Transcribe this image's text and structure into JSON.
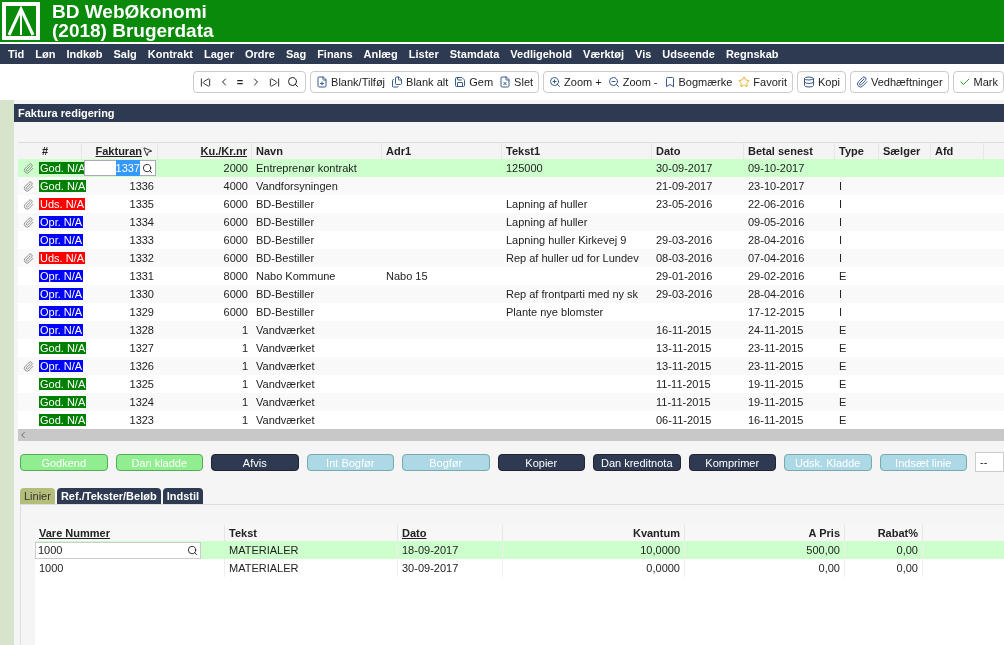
{
  "app": {
    "title": "BD WebØkonomi",
    "subtitle": "(2018) Brugerdata"
  },
  "menu": [
    "Tid",
    "Løn",
    "Indkøb",
    "Salg",
    "Kontrakt",
    "Lager",
    "Ordre",
    "Sag",
    "Finans",
    "Anlæg",
    "Lister",
    "Stamdata",
    "Vedligehold",
    "Værktøj",
    "Vis",
    "Udseende",
    "Regnskab"
  ],
  "toolbar": {
    "nav_label": "=",
    "groups": [
      [
        "Blank/Tilføj",
        "Blank alt",
        "Gem",
        "Slet"
      ],
      [
        "Zoom +",
        "Zoom -",
        "Bogmærke",
        "Favorit"
      ],
      [
        "Kopi"
      ],
      [
        "Vedhæftninger"
      ],
      [
        "Mark"
      ]
    ]
  },
  "panel": {
    "title": "Faktura redigering"
  },
  "table": {
    "columns": [
      {
        "label": "#",
        "sortable": false
      },
      {
        "label": "Fakturan",
        "sortable": true
      },
      {
        "label": "Ku./Kr.nr",
        "sortable": true
      },
      {
        "label": "Navn",
        "sortable": false
      },
      {
        "label": "Adr1",
        "sortable": false
      },
      {
        "label": "Tekst1",
        "sortable": false
      },
      {
        "label": "Dato",
        "sortable": false
      },
      {
        "label": "Betal senest",
        "sortable": false
      },
      {
        "label": "Type",
        "sortable": false
      },
      {
        "label": "Sælger",
        "sortable": false
      },
      {
        "label": "Afd",
        "sortable": false
      }
    ],
    "rows": [
      {
        "selected": true,
        "attachment": true,
        "status": "God. N/A",
        "color": "#008000",
        "fakturanr": "1337",
        "kunr": "2000",
        "navn": "Entreprenør kontrakt",
        "adr1": "",
        "tekst1": "125000",
        "dato": "30-09-2017",
        "betal": "09-10-2017",
        "type": ""
      },
      {
        "selected": false,
        "attachment": true,
        "status": "God. N/A",
        "color": "#008000",
        "fakturanr": "1336",
        "kunr": "4000",
        "navn": "Vandforsyningen",
        "adr1": "",
        "tekst1": "",
        "dato": "21-09-2017",
        "betal": "23-10-2017",
        "type": "I"
      },
      {
        "selected": false,
        "attachment": true,
        "status": "Uds. N/A",
        "color": "#ff0000",
        "fakturanr": "1335",
        "kunr": "6000",
        "navn": "BD-Bestiller",
        "adr1": "",
        "tekst1": "Lapning af huller",
        "dato": "23-05-2016",
        "betal": "22-06-2016",
        "type": "I"
      },
      {
        "selected": false,
        "attachment": true,
        "status": "Opr. N/A",
        "color": "#0000ff",
        "fakturanr": "1334",
        "kunr": "6000",
        "navn": "BD-Bestiller",
        "adr1": "",
        "tekst1": "Lapning af huller",
        "dato": "",
        "betal": "09-05-2016",
        "type": "I"
      },
      {
        "selected": false,
        "attachment": false,
        "status": "Opr. N/A",
        "color": "#0000ff",
        "fakturanr": "1333",
        "kunr": "6000",
        "navn": "BD-Bestiller",
        "adr1": "",
        "tekst1": "Lapning huller Kirkevej 9",
        "dato": "29-03-2016",
        "betal": "28-04-2016",
        "type": "I"
      },
      {
        "selected": false,
        "attachment": true,
        "status": "Uds. N/A",
        "color": "#ff0000",
        "fakturanr": "1332",
        "kunr": "6000",
        "navn": "BD-Bestiller",
        "adr1": "",
        "tekst1": "Rep af huller ud for Lundev",
        "dato": "08-03-2016",
        "betal": "07-04-2016",
        "type": "I"
      },
      {
        "selected": false,
        "attachment": false,
        "status": "Opr. N/A",
        "color": "#0000ff",
        "fakturanr": "1331",
        "kunr": "8000",
        "navn": "Nabo Kommune",
        "adr1": "Nabo 15",
        "tekst1": "",
        "dato": "29-01-2016",
        "betal": "29-02-2016",
        "type": "E"
      },
      {
        "selected": false,
        "attachment": false,
        "status": "Opr. N/A",
        "color": "#0000ff",
        "fakturanr": "1330",
        "kunr": "6000",
        "navn": "BD-Bestiller",
        "adr1": "",
        "tekst1": "Rep af frontparti med ny sk",
        "dato": "29-03-2016",
        "betal": "28-04-2016",
        "type": "I"
      },
      {
        "selected": false,
        "attachment": false,
        "status": "Opr. N/A",
        "color": "#0000ff",
        "fakturanr": "1329",
        "kunr": "6000",
        "navn": "BD-Bestiller",
        "adr1": "",
        "tekst1": "Plante nye blomster",
        "dato": "",
        "betal": "17-12-2015",
        "type": "I"
      },
      {
        "selected": false,
        "attachment": false,
        "status": "Opr. N/A",
        "color": "#0000ff",
        "fakturanr": "1328",
        "kunr": "1",
        "navn": "Vandværket",
        "adr1": "",
        "tekst1": "",
        "dato": "16-11-2015",
        "betal": "24-11-2015",
        "type": "E"
      },
      {
        "selected": false,
        "attachment": false,
        "status": "God. N/A",
        "color": "#008000",
        "fakturanr": "1327",
        "kunr": "1",
        "navn": "Vandværket",
        "adr1": "",
        "tekst1": "",
        "dato": "13-11-2015",
        "betal": "23-11-2015",
        "type": "E"
      },
      {
        "selected": false,
        "attachment": true,
        "status": "Opr. N/A",
        "color": "#0000ff",
        "fakturanr": "1326",
        "kunr": "1",
        "navn": "Vandværket",
        "adr1": "",
        "tekst1": "",
        "dato": "13-11-2015",
        "betal": "23-11-2015",
        "type": "E"
      },
      {
        "selected": false,
        "attachment": false,
        "status": "God. N/A",
        "color": "#008000",
        "fakturanr": "1325",
        "kunr": "1",
        "navn": "Vandværket",
        "adr1": "",
        "tekst1": "",
        "dato": "11-11-2015",
        "betal": "19-11-2015",
        "type": "E"
      },
      {
        "selected": false,
        "attachment": false,
        "status": "God. N/A",
        "color": "#008000",
        "fakturanr": "1324",
        "kunr": "1",
        "navn": "Vandværket",
        "adr1": "",
        "tekst1": "",
        "dato": "11-11-2015",
        "betal": "19-11-2015",
        "type": "E"
      },
      {
        "selected": false,
        "attachment": false,
        "status": "God. N/A",
        "color": "#008000",
        "fakturanr": "1323",
        "kunr": "1",
        "navn": "Vandværket",
        "adr1": "",
        "tekst1": "",
        "dato": "06-11-2015",
        "betal": "16-11-2015",
        "type": "E"
      }
    ]
  },
  "actions": [
    {
      "label": "Godkend",
      "kind": "confirm"
    },
    {
      "label": "Dan kladde",
      "kind": "confirm"
    },
    {
      "label": "Afvis",
      "kind": "action"
    },
    {
      "label": "Int Bogfør",
      "kind": "inactive"
    },
    {
      "label": "Bogfør",
      "kind": "inactive"
    },
    {
      "label": "Kopier",
      "kind": "action"
    },
    {
      "label": "Dan kreditnota",
      "kind": "action"
    },
    {
      "label": "Komprimer",
      "kind": "action"
    },
    {
      "label": "Udsk. Kladde",
      "kind": "inactive"
    },
    {
      "label": "Indsæt linie",
      "kind": "inactive"
    }
  ],
  "action_field": "--",
  "tabs": [
    {
      "label": "Linier",
      "selected": true
    },
    {
      "label": "Ref./Tekster/Beløb",
      "selected": false
    },
    {
      "label": "Indstil",
      "selected": false
    }
  ],
  "lines": {
    "columns": [
      {
        "label": "Vare Nummer",
        "sortable": true
      },
      {
        "label": "Tekst",
        "sortable": false
      },
      {
        "label": "Dato",
        "sortable": true
      },
      {
        "label": "Kvantum",
        "sortable": false
      },
      {
        "label": "A Pris",
        "sortable": false
      },
      {
        "label": "Rabat%",
        "sortable": false
      }
    ],
    "rows": [
      {
        "selected": true,
        "cells": [
          "1000",
          "MATERIALER",
          "18-09-2017",
          "10,0000",
          "500,00",
          "0,00"
        ]
      },
      {
        "selected": false,
        "cells": [
          "1000",
          "MATERIALER",
          "30-09-2017",
          "0,0000",
          "0,00",
          "0,00"
        ]
      }
    ]
  }
}
